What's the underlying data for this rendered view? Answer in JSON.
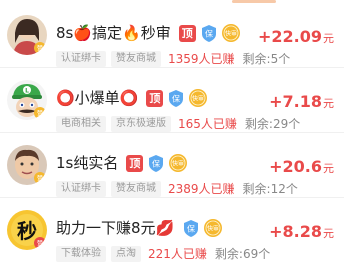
{
  "colors": {
    "accent": "#e94a4a",
    "tag_bg": "#f3f3f3",
    "tag_text": "#9a9a9a",
    "shield_blue": "#5aa8f0",
    "speed_gold": "#f5b82e"
  },
  "badges": {
    "ding": "顶",
    "bao": "保",
    "kuai": "快审"
  },
  "tasks": [
    {
      "title": "8s🍎搞定🔥秒审",
      "tags": [
        "认证绑卡",
        "赞友商城"
      ],
      "earned": "1359人已赚",
      "remaining": "剩余:5个",
      "reward": "+22.09",
      "unit": "元",
      "avatar": "photo-avatar-girl"
    },
    {
      "title": "⭕小爆单⭕",
      "tags": [
        "电商相关",
        "京东极速版"
      ],
      "earned": "165人已赚",
      "remaining": "剩余:29个",
      "reward": "+7.18",
      "unit": "元",
      "avatar": "luigi-avatar"
    },
    {
      "title": "1s纯实名",
      "tags": [
        "认证绑卡",
        "赞友商城"
      ],
      "earned": "2389人已赚",
      "remaining": "剩余:12个",
      "reward": "+20.6",
      "unit": "元",
      "avatar": "photo-avatar-man"
    },
    {
      "title": "助力一下赚8元💋",
      "tags": [
        "下载体验",
        "点淘"
      ],
      "earned": "221人已赚",
      "remaining": "剩余:69个",
      "reward": "+8.28",
      "unit": "元",
      "avatar": "miao-avatar",
      "avatar_text": "秒"
    }
  ]
}
